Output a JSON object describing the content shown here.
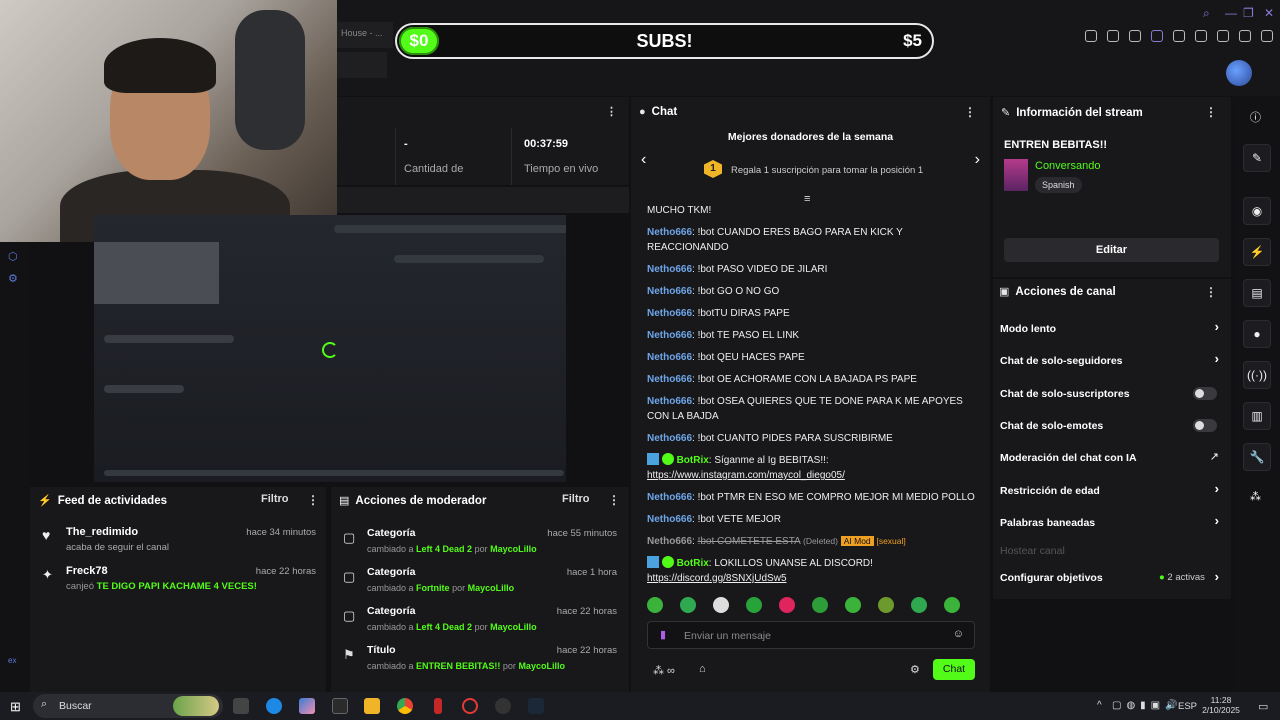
{
  "browser": {
    "tab_text": "House - ...",
    "window_controls": [
      "minimize",
      "restore",
      "close"
    ]
  },
  "subs_bar": {
    "left": "$0",
    "center": "SUBS!",
    "right": "$5"
  },
  "stats": {
    "first": {
      "value": "-",
      "label": "Cantidad de suscripciones"
    },
    "second": {
      "value": "00:37:59",
      "label": "Tiempo en vivo"
    }
  },
  "feed": {
    "title": "Feed de actividades",
    "filter": "Filtro",
    "items": [
      {
        "icon": "heart-icon",
        "user": "The_redimido",
        "text": "acaba de seguir el canal",
        "time": "hace 34 minutos"
      },
      {
        "icon": "kick-icon",
        "user": "Freck78",
        "text_prefix": "canjeó",
        "reward": "TE DIGO PAPI KACHAME 4 VECES!",
        "time": "hace 22 horas"
      }
    ]
  },
  "mod_actions": {
    "title": "Acciones de moderador",
    "filter": "Filtro",
    "items": [
      {
        "title": "Categoría",
        "time": "hace 55 minutos",
        "pre": "cambiado a",
        "value": "Left 4 Dead 2",
        "by": "por",
        "user": "MaycoLillo"
      },
      {
        "title": "Categoría",
        "time": "hace 1 hora",
        "pre": "cambiado a",
        "value": "Fortnite",
        "by": "por",
        "user": "MaycoLillo"
      },
      {
        "title": "Categoría",
        "time": "hace 22 horas",
        "pre": "cambiado a",
        "value": "Left 4 Dead 2",
        "by": "por",
        "user": "MaycoLillo"
      },
      {
        "title": "Título",
        "time": "hace 22 horas",
        "pre": "cambiado a",
        "value": "ENTREN BEBITAS!!",
        "by": "por",
        "user": "MaycoLillo"
      }
    ]
  },
  "chat": {
    "title": "Chat",
    "donors_title": "Mejores donadores de la semana",
    "donor_rank": "1",
    "donor_text": "Regala 1 suscripción para tomar la posición 1",
    "partial_line": "MUCHO TKM!",
    "messages": [
      {
        "user": "Netho666",
        "text": "!bot CUANDO ERES BAGO PARA EN KICK Y REACCIONANDO"
      },
      {
        "user": "Netho666",
        "text": "!bot PASO VIDEO DE JILARI"
      },
      {
        "user": "Netho666",
        "text": "!bot GO O NO GO"
      },
      {
        "user": "Netho666",
        "text": "!botTU DIRAS PAPE"
      },
      {
        "user": "Netho666",
        "text": "!bot TE PASO EL LINK"
      },
      {
        "user": "Netho666",
        "text": "!bot QEU HACES PAPE"
      },
      {
        "user": "Netho666",
        "text": "!bot OE ACHORAME CON LA BAJADA PS PAPE"
      },
      {
        "user": "Netho666",
        "text": "!bot OSEA QUIERES QUE TE DONE PARA K ME APOYES CON LA BAJDA"
      },
      {
        "user": "Netho666",
        "text": "!bot CUANTO PIDES PARA SUSCRIBIRME"
      }
    ],
    "botrix1": {
      "user": "BotRix",
      "text": "Síganme al Ig BEBITAS!!:",
      "link": "https://www.instagram.com/maycol_diego05/"
    },
    "messages2": [
      {
        "user": "Netho666",
        "text": "!bot PTMR EN ESO ME COMPRO MEJOR MI MEDIO POLLO"
      },
      {
        "user": "Netho666",
        "text": "!bot VETE MEJOR"
      }
    ],
    "deleted": {
      "user": "Netho666",
      "text": "!bot COMETETE ESTA",
      "tag": "(Deleted)",
      "badge": "AI Mod",
      "reason": "[sexual]"
    },
    "botrix2": {
      "user": "BotRix",
      "text": "LOKILLOS UNANSE AL DISCORD!",
      "link": "https://discord.gg/8SNXjUdSw5"
    },
    "input_placeholder": "Enviar un mensaje",
    "send_label": "Chat"
  },
  "stream_info": {
    "title": "Información del stream",
    "stream_title": "ENTREN BEBITAS!!",
    "category": "Conversando",
    "language": "Spanish",
    "edit_label": "Editar"
  },
  "channel_actions": {
    "title": "Acciones de canal",
    "items": [
      {
        "label": "Modo lento",
        "control": "chevron"
      },
      {
        "label": "Chat de solo-seguidores",
        "control": "chevron"
      },
      {
        "label": "Chat de solo-suscriptores",
        "control": "toggle"
      },
      {
        "label": "Chat de solo-emotes",
        "control": "toggle"
      },
      {
        "label": "Moderación del chat con IA",
        "control": "external"
      },
      {
        "label": "Restricción de edad",
        "control": "chevron"
      },
      {
        "label": "Palabras baneadas",
        "control": "chevron"
      }
    ],
    "host_label": "Hostear canal",
    "goals_label": "Configurar objetivos",
    "goals_count": "2 activas"
  },
  "taskbar": {
    "search": "Buscar",
    "lang": "ESP",
    "time": "11:28",
    "date": "2/10/2025"
  },
  "colors": {
    "accent": "#53fc18",
    "user": "#6ea6e8",
    "bg": "#18181b"
  }
}
